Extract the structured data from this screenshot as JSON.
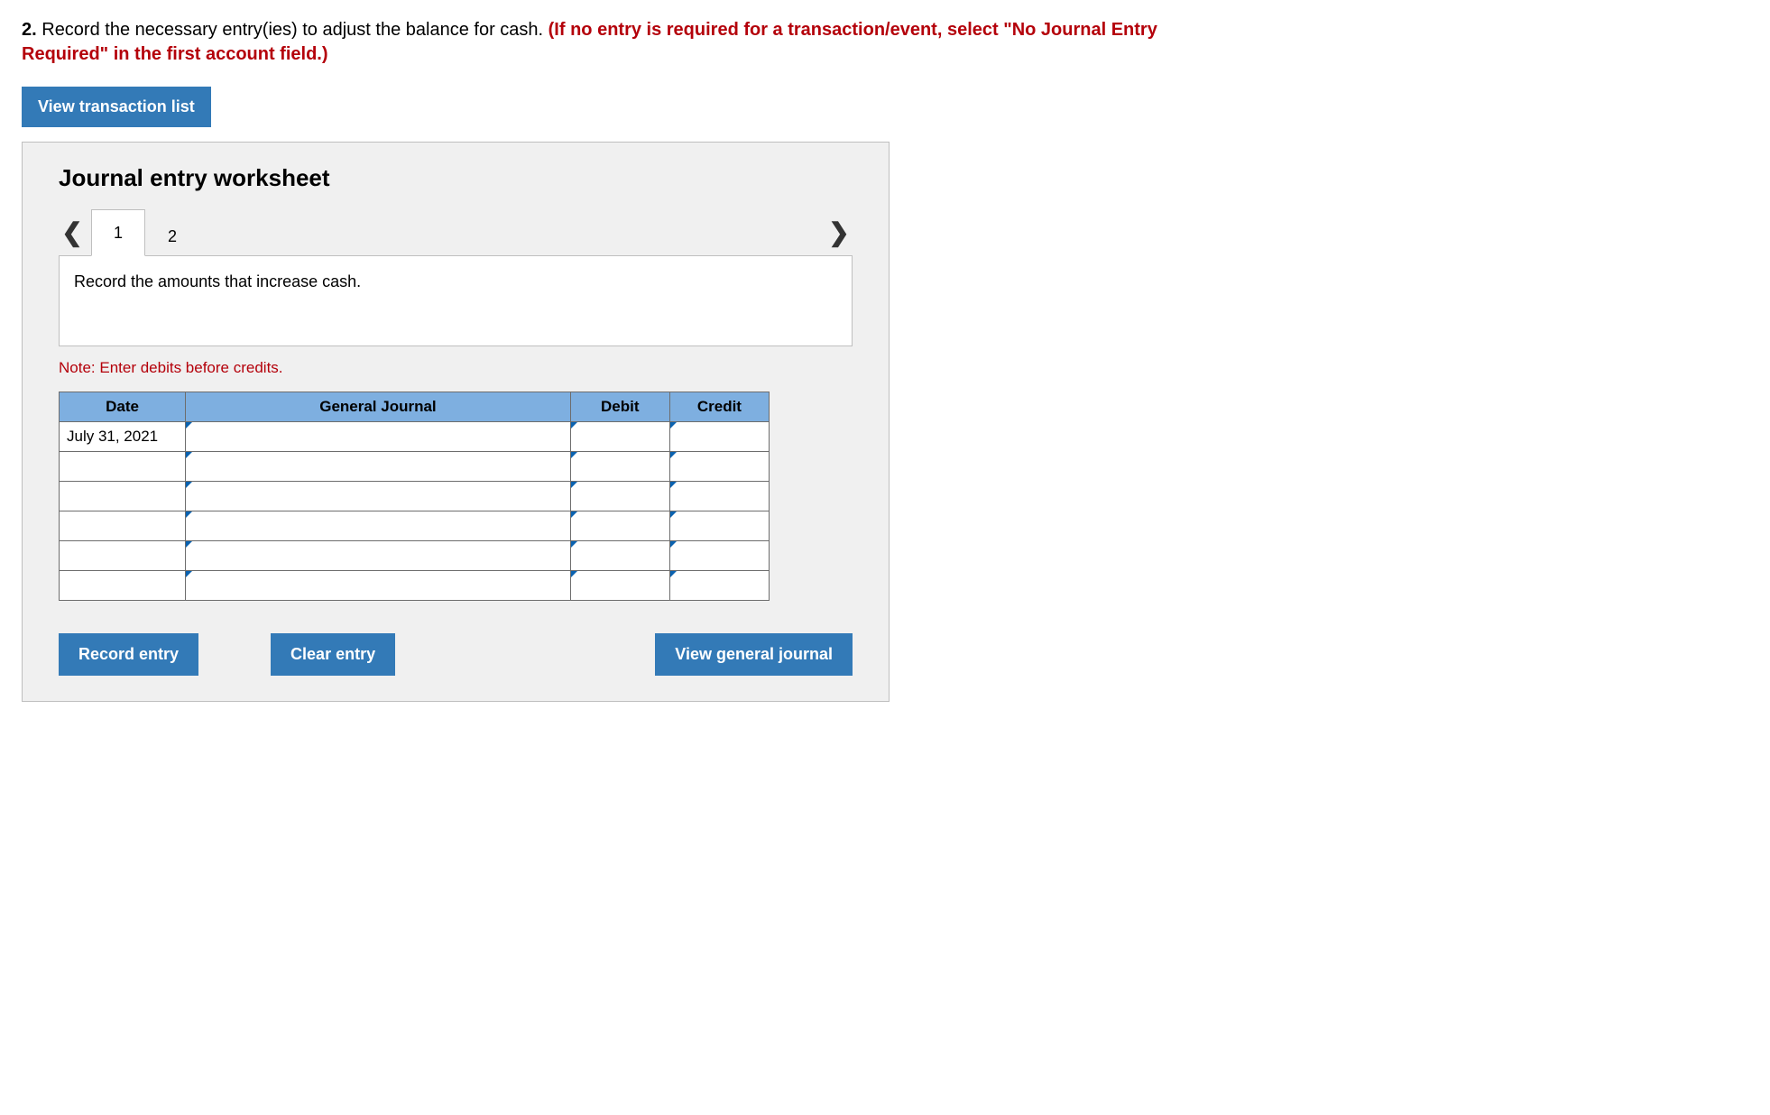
{
  "instruction": {
    "number": "2.",
    "black": " Record the necessary entry(ies) to adjust the balance for cash. ",
    "red": "(If no entry is required for a transaction/event, select \"No Journal Entry Required\" in the first account field.)"
  },
  "buttons": {
    "view_transaction_list": "View transaction list",
    "record_entry": "Record entry",
    "clear_entry": "Clear entry",
    "view_general_journal": "View general journal"
  },
  "worksheet": {
    "title": "Journal entry worksheet",
    "tabs": [
      "1",
      "2"
    ],
    "active_tab": 0,
    "prompt": "Record the amounts that increase cash.",
    "note": "Note: Enter debits before credits.",
    "headers": {
      "date": "Date",
      "general_journal": "General Journal",
      "debit": "Debit",
      "credit": "Credit"
    },
    "rows": [
      {
        "date": "July 31, 2021",
        "gj": "",
        "debit": "",
        "credit": ""
      },
      {
        "date": "",
        "gj": "",
        "debit": "",
        "credit": ""
      },
      {
        "date": "",
        "gj": "",
        "debit": "",
        "credit": ""
      },
      {
        "date": "",
        "gj": "",
        "debit": "",
        "credit": ""
      },
      {
        "date": "",
        "gj": "",
        "debit": "",
        "credit": ""
      },
      {
        "date": "",
        "gj": "",
        "debit": "",
        "credit": ""
      }
    ]
  },
  "colors": {
    "accent": "#337ab7",
    "header_cell": "#7eafe0",
    "danger": "#b4000a"
  }
}
